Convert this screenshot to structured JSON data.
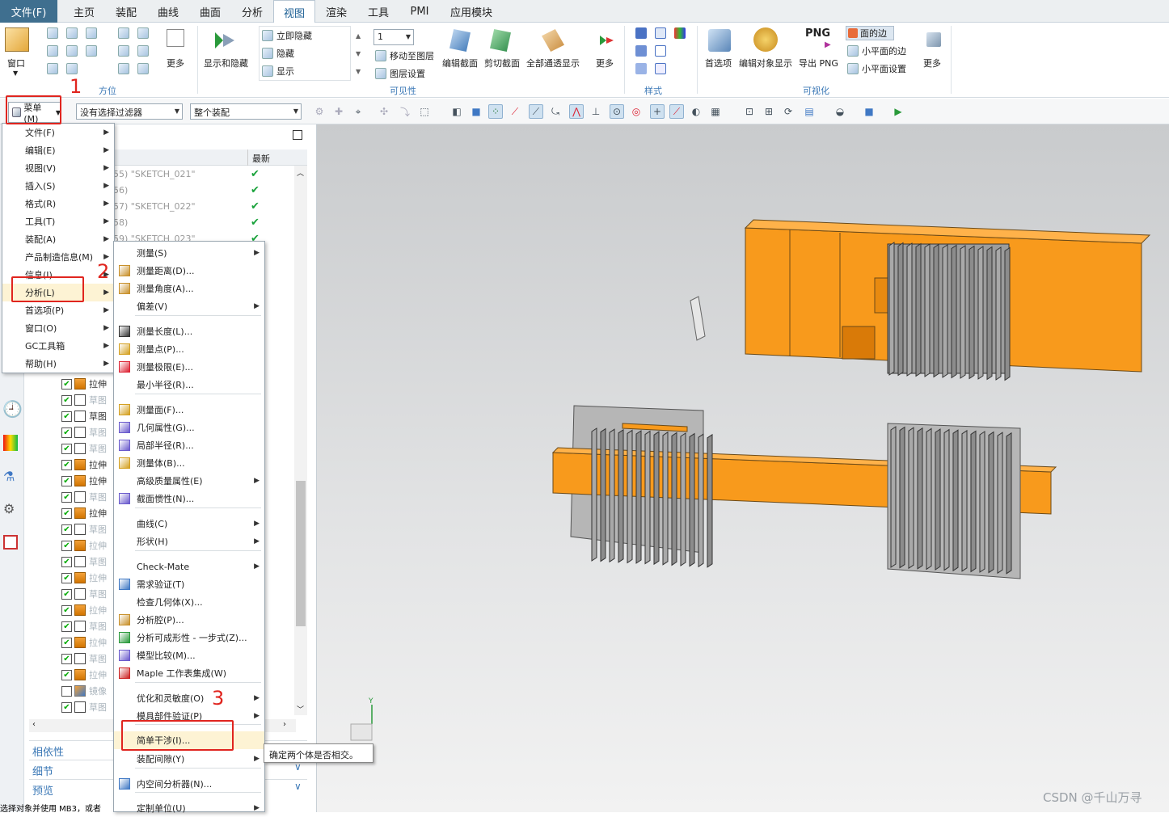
{
  "menubar": {
    "file": "文件(F)",
    "tabs": [
      "主页",
      "装配",
      "曲线",
      "曲面",
      "分析",
      "视图",
      "渲染",
      "工具",
      "PMI",
      "应用模块"
    ],
    "active_tab": "视图"
  },
  "ribbon": {
    "window_label": "窗口",
    "more_label": "更多",
    "orient_group": "方位",
    "show_hide": "显示和隐藏",
    "immediate_hide": "立即隐藏",
    "hide": "隐藏",
    "show": "显示",
    "layer_value": "1",
    "move_to_layer": "移动至图层",
    "layer_settings": "图层设置",
    "edit_section": "编辑截面",
    "clip_section": "剪切截面",
    "all_transparent": "全部通透显示",
    "visibility_group": "可见性",
    "style_group": "样式",
    "preferences": "首选项",
    "edit_obj_display": "编辑对象显示",
    "png": "PNG",
    "export_png": "导出 PNG",
    "face_edges": "面的边",
    "small_face_edges": "小平面的边",
    "small_face_settings": "小平面设置",
    "visualize_group": "可视化"
  },
  "cmdbar": {
    "menu_button": "菜单(M)",
    "filter": "没有选择过滤器",
    "scope": "整个装配"
  },
  "main_menu": {
    "items": [
      {
        "label": "文件(F)",
        "sub": true
      },
      {
        "label": "编辑(E)",
        "sub": true
      },
      {
        "label": "视图(V)",
        "sub": true
      },
      {
        "label": "插入(S)",
        "sub": true
      },
      {
        "label": "格式(R)",
        "sub": true
      },
      {
        "label": "工具(T)",
        "sub": true
      },
      {
        "label": "装配(A)",
        "sub": true
      },
      {
        "label": "产品制造信息(M)",
        "sub": true
      },
      {
        "label": "信息(I)",
        "sub": true
      },
      {
        "label": "分析(L)",
        "sub": true
      },
      {
        "label": "首选项(P)",
        "sub": true
      },
      {
        "label": "窗口(O)",
        "sub": true
      },
      {
        "label": "GC工具箱",
        "sub": true
      },
      {
        "label": "帮助(H)",
        "sub": true
      }
    ]
  },
  "analysis_menu": {
    "items": [
      {
        "label": "测量(S)",
        "sub": true
      },
      {
        "label": "测量距离(D)...",
        "sub": false
      },
      {
        "label": "测量角度(A)...",
        "sub": false
      },
      {
        "label": "偏差(V)",
        "sub": true
      },
      {
        "label": "测量长度(L)...",
        "sub": false
      },
      {
        "label": "测量点(P)...",
        "sub": false
      },
      {
        "label": "测量极限(E)...",
        "sub": false
      },
      {
        "label": "最小半径(R)...",
        "sub": false
      },
      {
        "label": "测量面(F)...",
        "sub": false
      },
      {
        "label": "几何属性(G)...",
        "sub": false
      },
      {
        "label": "局部半径(R)...",
        "sub": false
      },
      {
        "label": "测量体(B)...",
        "sub": false
      },
      {
        "label": "高级质量属性(E)",
        "sub": true
      },
      {
        "label": "截面惯性(N)...",
        "sub": false
      },
      {
        "label": "曲线(C)",
        "sub": true
      },
      {
        "label": "形状(H)",
        "sub": true
      },
      {
        "label": "Check-Mate",
        "sub": true
      },
      {
        "label": "需求验证(T)",
        "sub": false
      },
      {
        "label": "检查几何体(X)...",
        "sub": false
      },
      {
        "label": "分析腔(P)...",
        "sub": false
      },
      {
        "label": "分析可成形性 - 一步式(Z)...",
        "sub": false
      },
      {
        "label": "模型比较(M)...",
        "sub": false
      },
      {
        "label": "Maple 工作表集成(W)",
        "sub": false
      },
      {
        "label": "优化和灵敏度(O)",
        "sub": true
      },
      {
        "label": "模具部件验证(P)",
        "sub": true
      },
      {
        "label": "简单干涉(I)...",
        "sub": false
      },
      {
        "label": "装配间隙(Y)",
        "sub": true
      },
      {
        "label": "内空间分析器(N)...",
        "sub": false
      },
      {
        "label": "定制单位(U)",
        "sub": true
      }
    ]
  },
  "tooltip": "确定两个体是否相交。",
  "annotations": [
    "1",
    "2",
    "3"
  ],
  "navigator": {
    "col_latest": "最新",
    "top_rows": [
      {
        "text": "55) \"SKETCH_021\""
      },
      {
        "text": "56)"
      },
      {
        "text": "57) \"SKETCH_022\""
      },
      {
        "text": "58)"
      },
      {
        "text": "59) \"SKETCH_023\""
      }
    ],
    "rows": [
      {
        "type": "ext",
        "label": "拉伸",
        "checked": true,
        "dim": false
      },
      {
        "type": "sk",
        "label": "草图",
        "checked": true,
        "dim": true
      },
      {
        "type": "sk",
        "label": "草图",
        "checked": true,
        "dim": false
      },
      {
        "type": "sk",
        "label": "草图",
        "checked": true,
        "dim": true
      },
      {
        "type": "sk",
        "label": "草图",
        "checked": true,
        "dim": true
      },
      {
        "type": "ext",
        "label": "拉伸",
        "checked": true,
        "dim": false
      },
      {
        "type": "ext",
        "label": "拉伸",
        "checked": true,
        "dim": false
      },
      {
        "type": "sk",
        "label": "草图",
        "checked": true,
        "dim": true
      },
      {
        "type": "ext",
        "label": "拉伸",
        "checked": true,
        "dim": false
      },
      {
        "type": "sk",
        "label": "草图",
        "checked": true,
        "dim": true
      },
      {
        "type": "ext",
        "label": "拉伸",
        "checked": true,
        "dim": true
      },
      {
        "type": "sk",
        "label": "草图",
        "checked": true,
        "dim": true
      },
      {
        "type": "ext",
        "label": "拉伸",
        "checked": true,
        "dim": true
      },
      {
        "type": "sk",
        "label": "草图",
        "checked": true,
        "dim": true
      },
      {
        "type": "ext",
        "label": "拉伸",
        "checked": true,
        "dim": true
      },
      {
        "type": "sk",
        "label": "草图",
        "checked": true,
        "dim": true
      },
      {
        "type": "ext",
        "label": "拉伸",
        "checked": true,
        "dim": true
      },
      {
        "type": "sk",
        "label": "草图",
        "checked": true,
        "dim": true
      },
      {
        "type": "ext",
        "label": "拉伸",
        "checked": true,
        "dim": true
      },
      {
        "type": "mirror",
        "label": "镜像",
        "checked": false,
        "dim": true
      },
      {
        "type": "sk",
        "label": "草图",
        "checked": true,
        "dim": true
      }
    ],
    "dependencies": "相依性",
    "details": "细节",
    "preview": "预览"
  },
  "status_text": "选择对象并使用 MB3，或者",
  "watermark": "CSDN @千山万寻"
}
